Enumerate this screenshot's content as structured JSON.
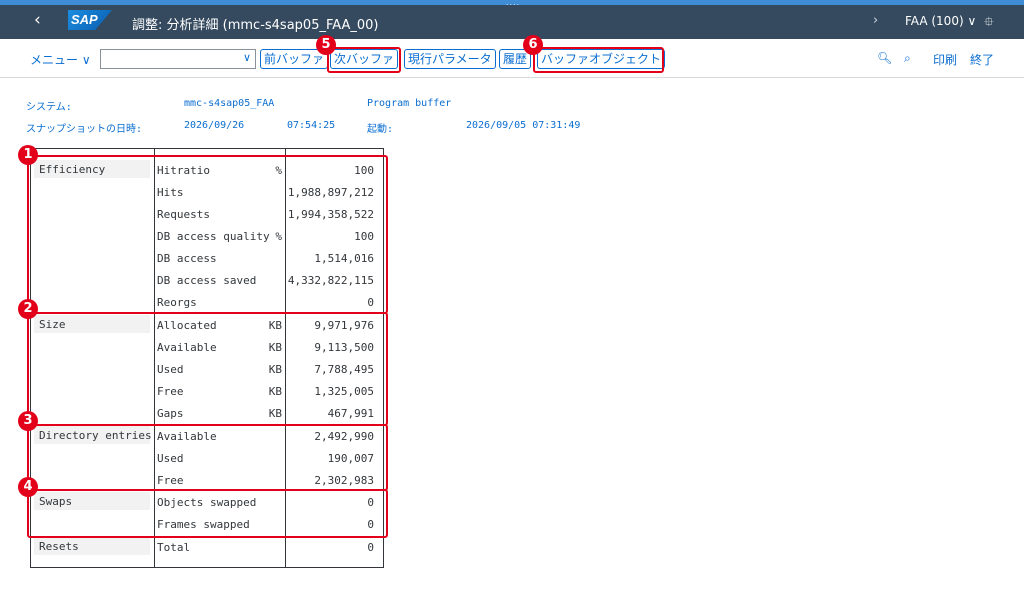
{
  "shell": {
    "back_icon": "back-icon",
    "logo": "SAP",
    "title": "調整: 分析詳細 (mmc-s4sap05_FAA_00)",
    "client": "FAA (100) ∨",
    "pin_icon": "pin-icon"
  },
  "toolbar": {
    "menu": "メニュー ∨",
    "combo_value": "",
    "buttons": [
      "前バッファ",
      "次バッファ",
      "現行パラメータ",
      "履歴",
      "バッファオブジェクト"
    ],
    "print": "印刷",
    "exit": "終了"
  },
  "info": {
    "system_label": "システム:",
    "system_value": "mmc-s4sap05_FAA",
    "buffer": "Program buffer",
    "snapshot_label": "スナップショットの日時:",
    "snapshot_date": "2026/09/26",
    "snapshot_time": "07:54:25",
    "startup_label": "起動:",
    "startup_value": "2026/09/05 07:31:49"
  },
  "badges": [
    "1",
    "2",
    "3",
    "4",
    "5",
    "6"
  ],
  "report": {
    "efficiency": {
      "label": "Efficiency",
      "rows": [
        {
          "name": "Hitratio",
          "unit": "%",
          "value": "100"
        },
        {
          "name": "Hits",
          "unit": "",
          "value": "1,988,897,212"
        },
        {
          "name": "Requests",
          "unit": "",
          "value": "1,994,358,522"
        },
        {
          "name": "DB access quality",
          "unit": "%",
          "value": "100"
        },
        {
          "name": "DB access",
          "unit": "",
          "value": "1,514,016"
        },
        {
          "name": "DB access saved",
          "unit": "",
          "value": "4,332,822,115"
        },
        {
          "name": "Reorgs",
          "unit": "",
          "value": "0"
        }
      ]
    },
    "size": {
      "label": "Size",
      "rows": [
        {
          "name": "Allocated",
          "unit": "KB",
          "value": "9,971,976"
        },
        {
          "name": "Available",
          "unit": "KB",
          "value": "9,113,500"
        },
        {
          "name": "Used",
          "unit": "KB",
          "value": "7,788,495"
        },
        {
          "name": "Free",
          "unit": "KB",
          "value": "1,325,005"
        },
        {
          "name": "Gaps",
          "unit": "KB",
          "value": "467,991"
        }
      ]
    },
    "directory": {
      "label": "Directory entries",
      "rows": [
        {
          "name": "Available",
          "unit": "",
          "value": "2,492,990"
        },
        {
          "name": "Used",
          "unit": "",
          "value": "190,007"
        },
        {
          "name": "Free",
          "unit": "",
          "value": "2,302,983"
        }
      ]
    },
    "swaps": {
      "label": "Swaps",
      "rows": [
        {
          "name": "Objects swapped",
          "unit": "",
          "value": "0"
        },
        {
          "name": "Frames swapped",
          "unit": "",
          "value": "0"
        }
      ]
    },
    "resets": {
      "label": "Resets",
      "rows": [
        {
          "name": "Total",
          "unit": "",
          "value": "0"
        }
      ]
    }
  },
  "colors": {
    "shell": "#354a5f",
    "accent": "#0a6ed1",
    "highlight": "#e3001b"
  }
}
